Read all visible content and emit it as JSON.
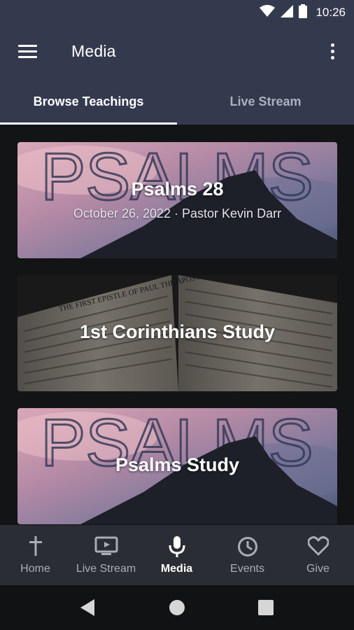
{
  "status_bar": {
    "time": "10:26",
    "icons": [
      "wifi-icon",
      "cell-signal-icon",
      "battery-icon"
    ]
  },
  "app_bar": {
    "title": "Media",
    "menu_icon": "hamburger-menu-icon",
    "overflow_icon": "more-vert-icon"
  },
  "tabs": [
    {
      "label": "Browse Teachings",
      "selected": true
    },
    {
      "label": "Live Stream",
      "selected": false
    }
  ],
  "cards": [
    {
      "title": "Psalms 28",
      "subtitle": "October 26, 2022 · Pastor Kevin Darr",
      "image_text": "PSALMS"
    },
    {
      "title": "1st Corinthians Study",
      "subtitle": "",
      "image_text": "THE FIRST EPISTLE OF PAUL THE APOSTLE"
    },
    {
      "title": "Psalms Study",
      "subtitle": "",
      "image_text": "PSALMS"
    }
  ],
  "bottom_nav": [
    {
      "label": "Home",
      "icon": "cross-icon",
      "active": false
    },
    {
      "label": "Live Stream",
      "icon": "tv-icon",
      "active": false
    },
    {
      "label": "Media",
      "icon": "microphone-icon",
      "active": true
    },
    {
      "label": "Events",
      "icon": "clock-icon",
      "active": false
    },
    {
      "label": "Give",
      "icon": "heart-icon",
      "active": false
    }
  ],
  "system_nav": [
    "back-icon",
    "home-icon",
    "recents-icon"
  ],
  "colors": {
    "app_bar": "#343a4e",
    "background": "#121416",
    "bottom_nav": "#2a2d33",
    "tab_selected": "#ffffff",
    "tab_unselected": "#aab0c0"
  }
}
